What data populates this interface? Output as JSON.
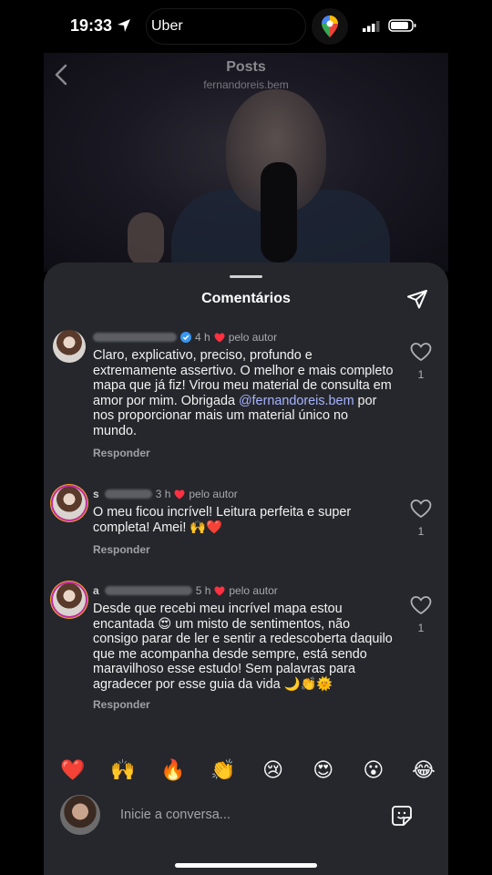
{
  "status_bar": {
    "time": "19:33",
    "island_label": "Uber"
  },
  "header": {
    "title": "Posts",
    "subtitle": "fernandoreis.bem"
  },
  "sheet": {
    "title": "Comentários"
  },
  "comments": [
    {
      "time": "4 h",
      "liked_by_author": "pelo autor",
      "verified": true,
      "text_before": "Claro, explicativo, preciso, profundo e extremamente assertivo. O melhor e mais completo mapa que já fiz! Virou meu material de consulta em amor por mim. Obrigada ",
      "mention": "@fernandoreis.bem",
      "text_after": " por nos proporcionar mais um material único no mundo.",
      "reply_label": "Responder",
      "likes": "1"
    },
    {
      "name_initial": "s",
      "time": "3 h",
      "liked_by_author": "pelo autor",
      "text": "O meu ficou incrível! Leitura perfeita e super completa! Amei! 🙌❤️",
      "reply_label": "Responder",
      "likes": "1"
    },
    {
      "name_initial": "a",
      "time": "5 h",
      "liked_by_author": "pelo autor",
      "text": "Desde que recebi meu incrível mapa estou encantada 😍 um misto de sentimentos, não consigo parar de ler e sentir a redescoberta daquilo que me acompanha desde sempre, está sendo maravilhoso esse estudo! Sem palavras para agradecer por esse guia da vida 🌙👏🌞",
      "reply_label": "Responder",
      "likes": "1"
    }
  ],
  "quick_reactions": [
    "❤️",
    "🙌",
    "🔥",
    "👏",
    "😢",
    "😍",
    "😮",
    "😂"
  ],
  "composer": {
    "placeholder": "Inicie a conversa..."
  },
  "colors": {
    "sheet_bg": "#25272c",
    "heart_red": "#ff3040",
    "verified_blue": "#3897f0",
    "mention": "#a7b3ff"
  }
}
